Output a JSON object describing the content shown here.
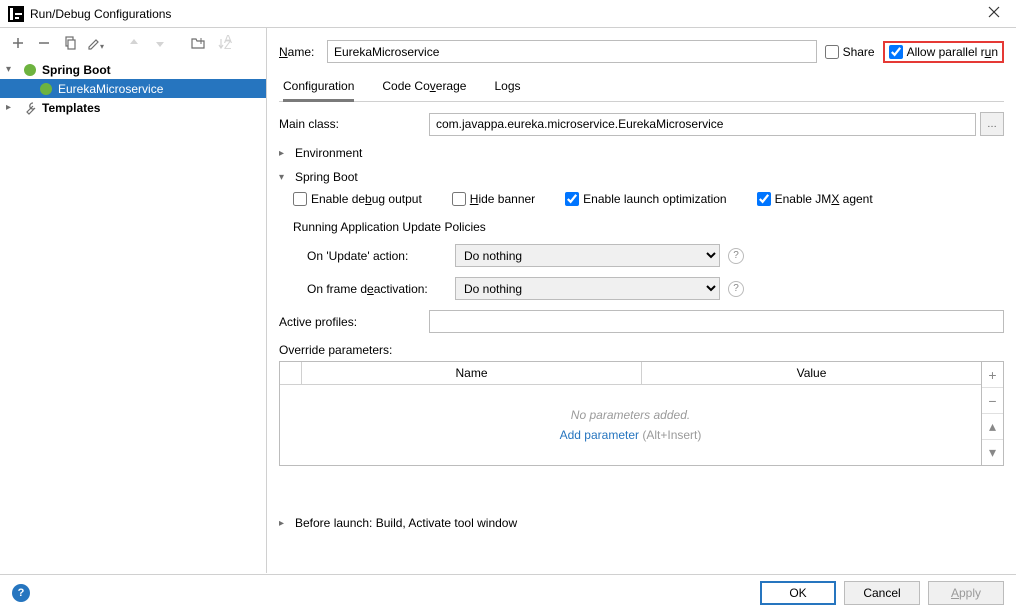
{
  "titlebar": {
    "title": "Run/Debug Configurations"
  },
  "sidebar": {
    "nodes": {
      "springboot": {
        "label": "Spring Boot"
      },
      "eureka": {
        "label": "EurekaMicroservice"
      },
      "templates": {
        "label": "Templates"
      }
    }
  },
  "form": {
    "name_label": "Name:",
    "name_value": "EurekaMicroservice",
    "share_label": "Share",
    "allow_parallel_label": "Allow parallel run"
  },
  "tabs": {
    "configuration": "Configuration",
    "coverage": "Code Coverage",
    "logs": "Logs"
  },
  "config": {
    "main_class_label": "Main class:",
    "main_class_value": "com.javappa.eureka.microservice.EurekaMicroservice",
    "env_header": "Environment",
    "sb_header": "Spring Boot",
    "enable_debug": "Enable debug output",
    "hide_banner": "Hide banner",
    "enable_launch_opt": "Enable launch optimization",
    "enable_jmx": "Enable JMX agent",
    "policies_header": "Running Application Update Policies",
    "on_update_label": "On 'Update' action:",
    "on_update_value": "Do nothing",
    "on_deactivate_label": "On frame deactivation:",
    "on_deactivate_value": "Do nothing",
    "active_profiles_label": "Active profiles:",
    "active_profiles_value": "",
    "override_label": "Override parameters:",
    "override_cols": {
      "name": "Name",
      "value": "Value"
    },
    "override_empty": "No parameters added.",
    "override_add": "Add parameter",
    "override_hint": "(Alt+Insert)",
    "before_launch": "Before launch: Build, Activate tool window"
  },
  "footer": {
    "ok": "OK",
    "cancel": "Cancel",
    "apply": "Apply"
  }
}
